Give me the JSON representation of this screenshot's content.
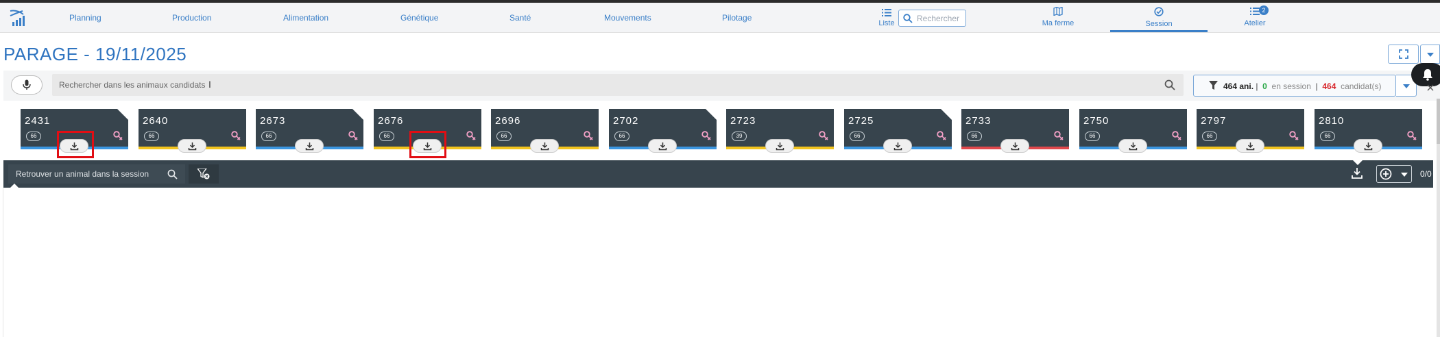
{
  "nav": {
    "items": [
      "Planning",
      "Production",
      "Alimentation",
      "Génétique",
      "Santé",
      "Mouvements",
      "Pilotage"
    ],
    "list_label": "Liste",
    "search_placeholder": "Rechercher",
    "ma_ferme": "Ma ferme",
    "session": "Session",
    "atelier": "Atelier",
    "atelier_badge": "2"
  },
  "page": {
    "title": "PARAGE - 19/11/2025"
  },
  "search": {
    "placeholder": "Rechercher dans les animaux candidats",
    "cursor": "I"
  },
  "filter": {
    "count": "464 ani.",
    "sep1": "|",
    "in_session": "0",
    "in_session_label": "en session",
    "sep2": "|",
    "candidates": "464",
    "candidates_label": "candidat(s)"
  },
  "cards": [
    {
      "number": "2431",
      "pill": "66",
      "bar": "blue",
      "corner": true
    },
    {
      "number": "2640",
      "pill": "66",
      "bar": "yellow",
      "corner": false
    },
    {
      "number": "2673",
      "pill": "66",
      "bar": "blue",
      "corner": true
    },
    {
      "number": "2676",
      "pill": "66",
      "bar": "yellow",
      "corner": false
    },
    {
      "number": "2696",
      "pill": "66",
      "bar": "yellow",
      "corner": false
    },
    {
      "number": "2702",
      "pill": "66",
      "bar": "blue",
      "corner": true
    },
    {
      "number": "2723",
      "pill": "39",
      "bar": "yellow",
      "corner": false
    },
    {
      "number": "2725",
      "pill": "66",
      "bar": "blue",
      "corner": true
    },
    {
      "number": "2733",
      "pill": "66",
      "bar": "red",
      "corner": false
    },
    {
      "number": "2750",
      "pill": "66",
      "bar": "blue",
      "corner": false
    },
    {
      "number": "2797",
      "pill": "66",
      "bar": "yellow",
      "corner": false
    },
    {
      "number": "2810",
      "pill": "66",
      "bar": "blue",
      "corner": false
    }
  ],
  "bar_colors": {
    "blue": "#3b96e0",
    "yellow": "#f2c41e",
    "red": "#e0484c"
  },
  "session_bar": {
    "search_placeholder": "Retrouver un animal dans la session",
    "counter": "0/0"
  },
  "colors": {
    "accent": "#3a7fc8",
    "dark": "#37444d",
    "highlight": "#e10e14"
  }
}
